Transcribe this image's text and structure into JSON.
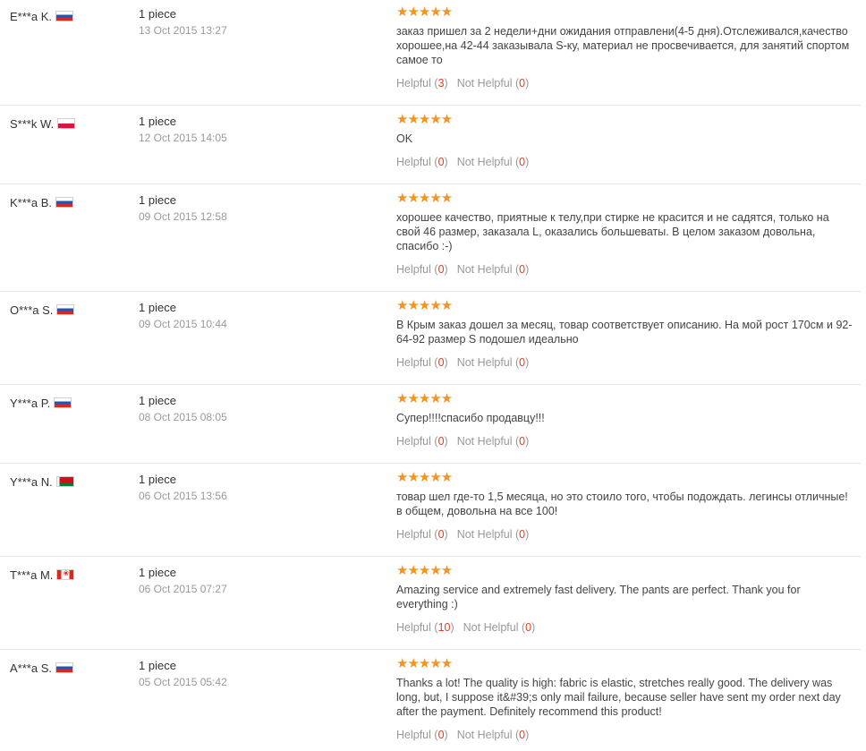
{
  "colors": {
    "star": "#f7931e",
    "count": "#e0421e",
    "meta": "#999999",
    "divider": "#e6e6e6"
  },
  "labels": {
    "helpful": "Helpful",
    "not_helpful": "Not Helpful"
  },
  "reviews": [
    {
      "user": "E***a K.",
      "country": "ru",
      "quantity": "1 piece",
      "date": "13 Oct 2015 13:27",
      "rating": 5,
      "stars": "★★★★★",
      "text": "заказ пришел за 2 недели+дни ожидания отправлени(4-5 дня).Отслеживался,качество хорошее,на 42-44 заказывала S-ку, материал не просвечивается, для занятий спортом самое то",
      "helpful": "3",
      "not_helpful": "0"
    },
    {
      "user": "S***k W.",
      "country": "pl",
      "quantity": "1 piece",
      "date": "12 Oct 2015 14:05",
      "rating": 5,
      "stars": "★★★★★",
      "text": "OK",
      "helpful": "0",
      "not_helpful": "0"
    },
    {
      "user": "K***a B.",
      "country": "ru",
      "quantity": "1 piece",
      "date": "09 Oct 2015 12:58",
      "rating": 5,
      "stars": "★★★★★",
      "text": "хорошее качество, приятные к телу,при стирке не красится и не садятся, только на свой 46 размер, заказала L, оказались большеваты. В целом заказом довольна, спасибо :-)",
      "helpful": "0",
      "not_helpful": "0"
    },
    {
      "user": "O***a S.",
      "country": "ru",
      "quantity": "1 piece",
      "date": "09 Oct 2015 10:44",
      "rating": 5,
      "stars": "★★★★★",
      "text": "В Крым заказ дошел за месяц, товар соответствует описанию. На мой рост 170см и 92-64-92 размер S подошел идеально",
      "helpful": "0",
      "not_helpful": "0"
    },
    {
      "user": "Y***a P.",
      "country": "ru",
      "quantity": "1 piece",
      "date": "08 Oct 2015 08:05",
      "rating": 5,
      "stars": "★★★★★",
      "text": "Супер!!!!спасибо продавцу!!!",
      "helpful": "0",
      "not_helpful": "0"
    },
    {
      "user": "Y***a N.",
      "country": "by",
      "quantity": "1 piece",
      "date": "06 Oct 2015 13:56",
      "rating": 5,
      "stars": "★★★★★",
      "text": "товар шел где-то 1,5 месяца, но это стоило того, чтобы подождать. легинсы отличные! в общем, довольна на все 100!",
      "helpful": "0",
      "not_helpful": "0"
    },
    {
      "user": "T***a M.",
      "country": "ca",
      "quantity": "1 piece",
      "date": "06 Oct 2015 07:27",
      "rating": 5,
      "stars": "★★★★★",
      "text": "Amazing service and extremely fast delivery. The pants are perfect. Thank you for everything :)",
      "helpful": "10",
      "not_helpful": "0"
    },
    {
      "user": "A***a S.",
      "country": "ru",
      "quantity": "1 piece",
      "date": "05 Oct 2015 05:42",
      "rating": 5,
      "stars": "★★★★★",
      "text": "Thanks a lot! The quality is high: fabric is elastic, stretches really good. The delivery was long, but, I suppose it&#39;s only mail failure, because seller have sent my order next day after the payment. Definitely recommend this product!",
      "helpful": "0",
      "not_helpful": "0"
    }
  ]
}
